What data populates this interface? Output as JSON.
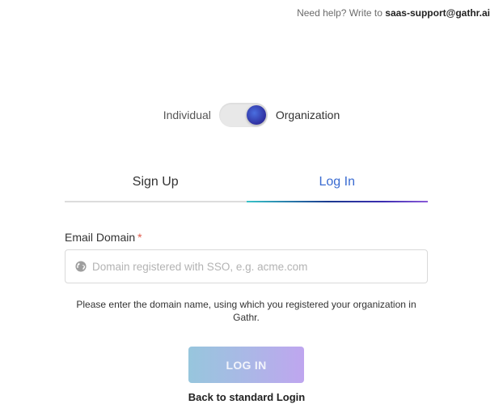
{
  "help": {
    "prefix": "Need help? Write to ",
    "email": "saas-support@gathr.ai"
  },
  "account_type": {
    "left_label": "Individual",
    "right_label": "Organization",
    "selected": "Organization",
    "knob_color": "#2f2f9f"
  },
  "tabs": [
    {
      "label": "Sign Up",
      "active": false
    },
    {
      "label": "Log In",
      "active": true
    }
  ],
  "form": {
    "email_domain_label": "Email Domain",
    "required_marker": "*",
    "email_domain_placeholder": "Domain registered with SSO, e.g. acme.com",
    "email_domain_value": "",
    "input_icon": "globe-icon",
    "hint": "Please enter the domain name, using which you registered your organization in Gathr.",
    "submit_label": "LOG IN",
    "back_link": "Back to standard Login"
  },
  "colors": {
    "accent": "#3a6bd1",
    "required": "#e05a4a",
    "button_gradient_start": "#97c6dd",
    "button_gradient_end": "#bfa6ef"
  }
}
